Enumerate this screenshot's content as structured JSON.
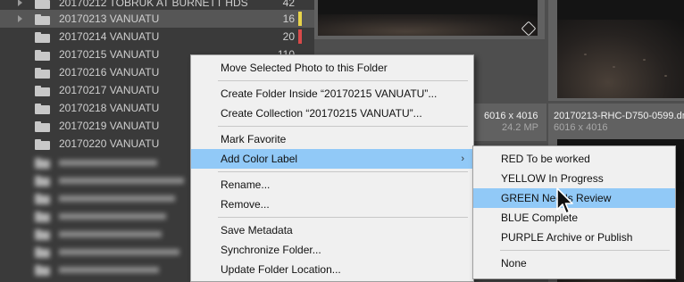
{
  "folders": [
    {
      "name": "20170212 TOBRUK AT BURNETT HDS",
      "count": "42",
      "color": ""
    },
    {
      "name": "20170213 VANUATU",
      "count": "16",
      "color": "#e8d44a"
    },
    {
      "name": "20170214 VANUATU",
      "count": "20",
      "color": "#d84a4a"
    },
    {
      "name": "20170215 VANUATU",
      "count": "110",
      "color": ""
    },
    {
      "name": "20170216 VANUATU",
      "count": "",
      "color": ""
    },
    {
      "name": "20170217 VANUATU",
      "count": "",
      "color": ""
    },
    {
      "name": "20170218 VANUATU",
      "count": "",
      "color": ""
    },
    {
      "name": "20170219 VANUATU",
      "count": "",
      "color": ""
    },
    {
      "name": "20170220 VANUATU",
      "count": "",
      "color": ""
    }
  ],
  "grid": {
    "cell1": {
      "dimensions": "6016 x 4016",
      "size": "24.2 MP"
    },
    "cell2": {
      "filename": "20170213-RHC-D750-0599.dn",
      "dimensions": "6016 x 4016"
    }
  },
  "context_menu": {
    "move": "Move Selected Photo to this Folder",
    "create_folder": "Create Folder Inside “20170215 VANUATU”...",
    "create_collection": "Create Collection “20170215 VANUATU”...",
    "mark_favorite": "Mark Favorite",
    "add_color_label": "Add Color Label",
    "submenu_arrow": "›",
    "rename": "Rename...",
    "remove": "Remove...",
    "save_metadata": "Save Metadata",
    "synchronize": "Synchronize Folder...",
    "update_location": "Update Folder Location..."
  },
  "color_submenu": {
    "red": "RED  To be worked",
    "yellow": "YELLOW In Progress",
    "green": "GREEN Needs Review",
    "blue": "BLUE Complete",
    "purple": "PURPLE Archive or Publish",
    "none": "None"
  },
  "colors": {
    "menu_highlight": "#91c9f7",
    "yellow_label": "#e8d44a",
    "red_label": "#d84a4a"
  }
}
